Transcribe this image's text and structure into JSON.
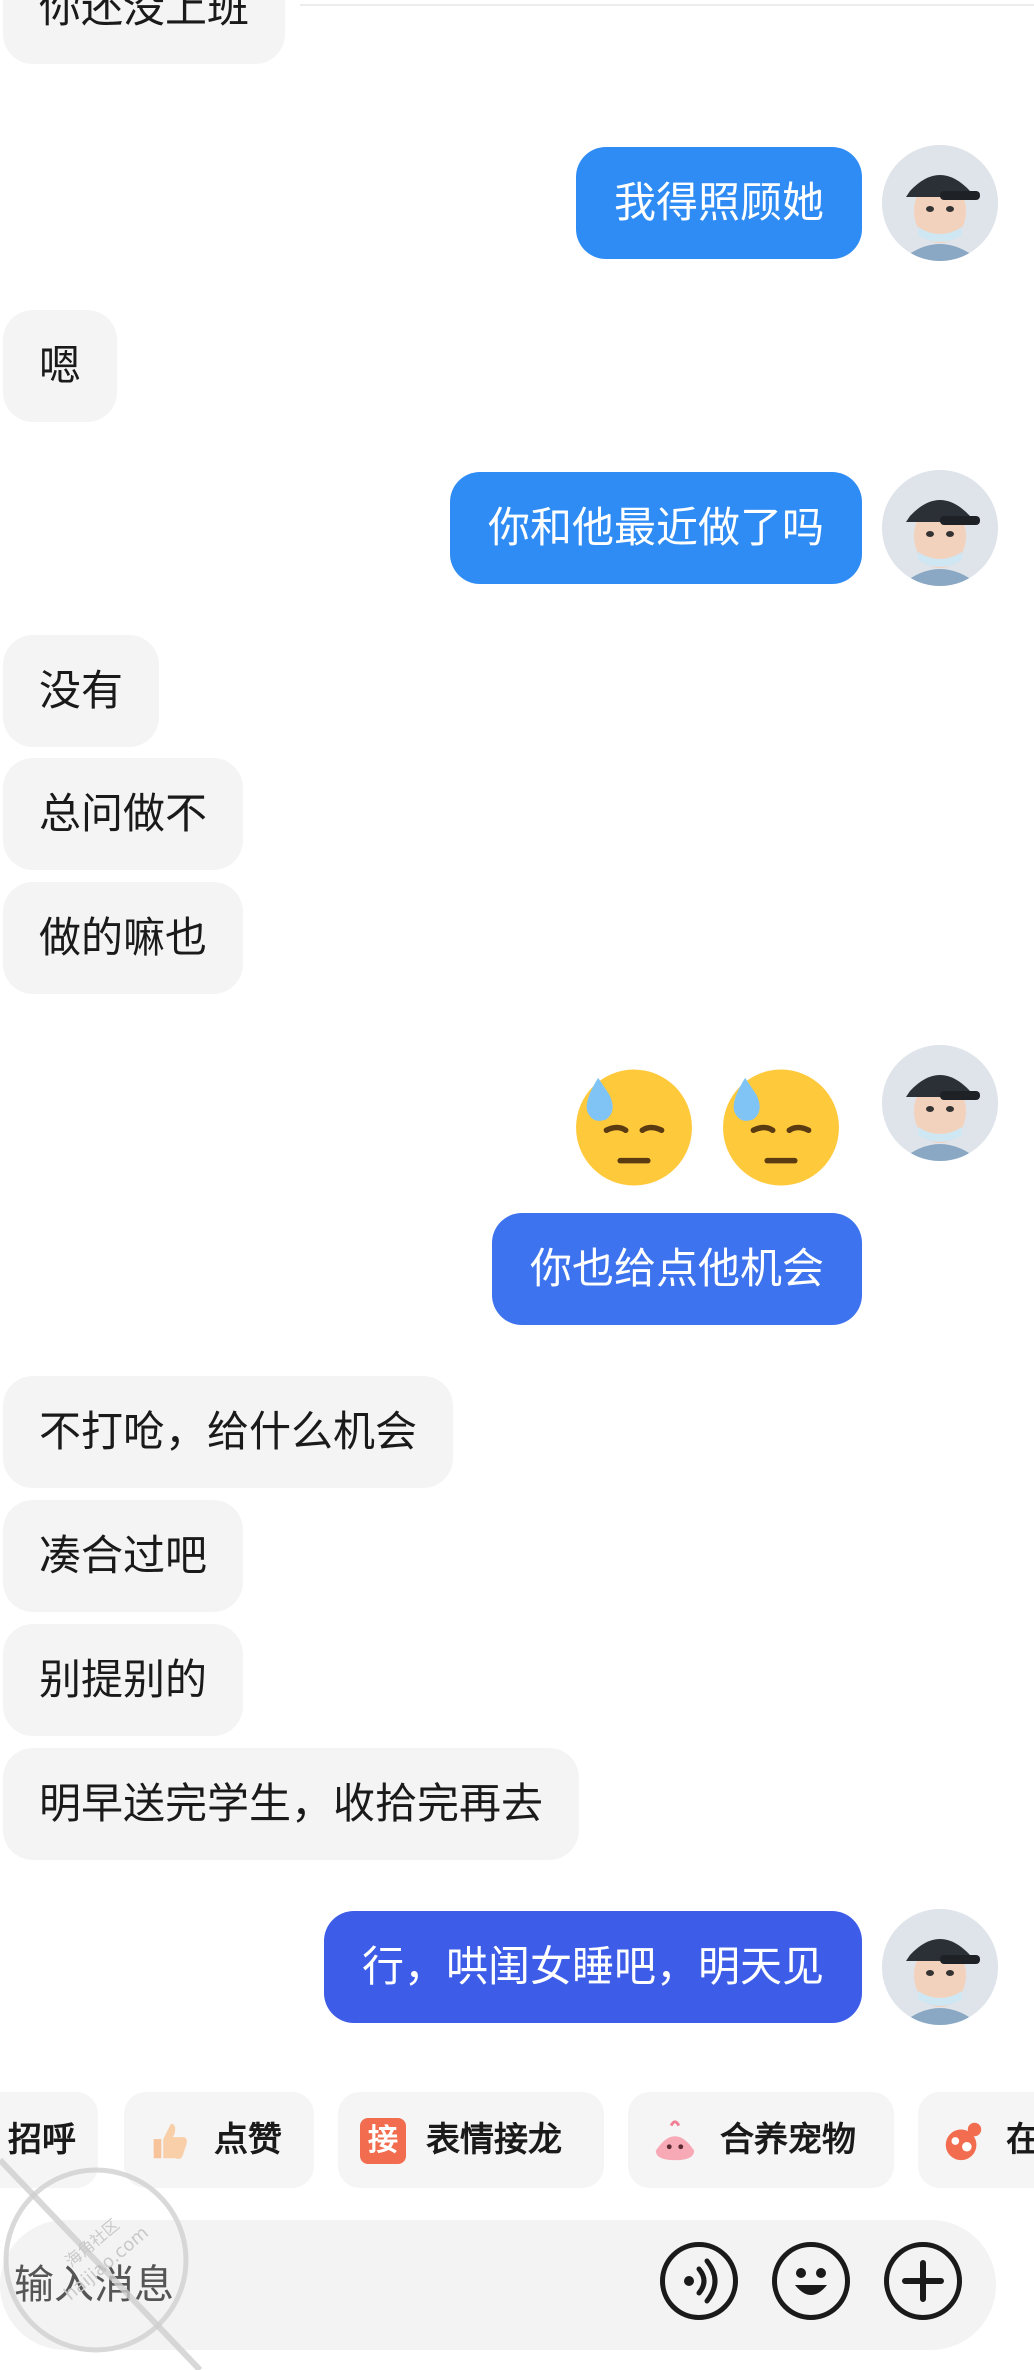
{
  "colors": {
    "incoming_bg": "#f4f4f5",
    "outgoing_light": "#2f8cf4",
    "outgoing_mid": "#3d73ee",
    "outgoing_deep": "#3d5ce8"
  },
  "messages": [
    {
      "side": "in",
      "text": "你还没上班"
    },
    {
      "side": "out",
      "text": "我得照顾她"
    },
    {
      "side": "in",
      "text": "嗯"
    },
    {
      "side": "out",
      "text": "你和他最近做了吗"
    },
    {
      "side": "in",
      "text": "没有"
    },
    {
      "side": "in",
      "text": "总问做不"
    },
    {
      "side": "in",
      "text": "做的嘛也"
    },
    {
      "side": "out",
      "type": "emoji",
      "emoji": [
        "downcast-face-with-sweat-icon",
        "downcast-face-with-sweat-icon"
      ]
    },
    {
      "side": "out",
      "text": "你也给点他机会"
    },
    {
      "side": "in",
      "text": "不打呛，给什么机会"
    },
    {
      "side": "in",
      "text": "凑合过吧"
    },
    {
      "side": "in",
      "text": "别提别的"
    },
    {
      "side": "in",
      "text": "明早送完学生，收拾完再去"
    },
    {
      "side": "out",
      "text": "行，哄闺女睡吧，明天见"
    }
  ],
  "quick_actions": [
    {
      "label": "招呼",
      "icon": null
    },
    {
      "label": "点赞",
      "icon": "thumbs-up-icon"
    },
    {
      "label": "表情接龙",
      "icon": "jie-badge-icon",
      "icon_text": "接"
    },
    {
      "label": "合养宠物",
      "icon": "pet-icon"
    },
    {
      "label": "在",
      "icon": "more-feature-icon"
    }
  ],
  "input": {
    "placeholder": "输入消息",
    "voice_icon": "voice-icon",
    "emoji_icon": "emoji-smile-icon",
    "plus_icon": "plus-icon"
  },
  "watermark": {
    "line1": "海角社区",
    "line2": "haijiao.com"
  }
}
